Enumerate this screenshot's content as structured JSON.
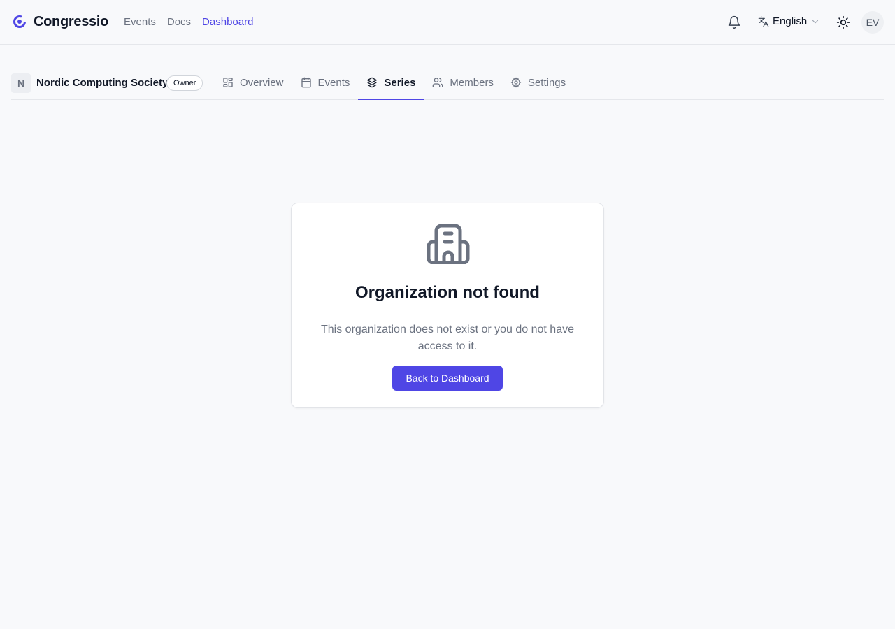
{
  "header": {
    "brand": "Congressio",
    "nav": [
      {
        "label": "Events",
        "active": false
      },
      {
        "label": "Docs",
        "active": false
      },
      {
        "label": "Dashboard",
        "active": true
      }
    ],
    "language": "English",
    "avatar_initials": "EV",
    "icons": [
      "bell-icon",
      "translate-icon",
      "chevron-down-icon",
      "sun-icon"
    ]
  },
  "org": {
    "initial": "N",
    "name": "Nordic Computing Society",
    "role": "Owner",
    "tabs": [
      {
        "label": "Overview",
        "icon": "grid-icon",
        "active": false
      },
      {
        "label": "Events",
        "icon": "calendar-icon",
        "active": false
      },
      {
        "label": "Series",
        "icon": "layers-icon",
        "active": true
      },
      {
        "label": "Members",
        "icon": "users-icon",
        "active": false
      },
      {
        "label": "Settings",
        "icon": "gear-icon",
        "active": false
      }
    ]
  },
  "empty_state": {
    "icon": "building-icon",
    "title": "Organization not found",
    "description": "This organization does not exist or you do not have access to it.",
    "button": "Back to Dashboard"
  },
  "colors": {
    "accent": "#4f46e5",
    "background": "#f8f9fb",
    "muted_text": "#6b7280"
  }
}
